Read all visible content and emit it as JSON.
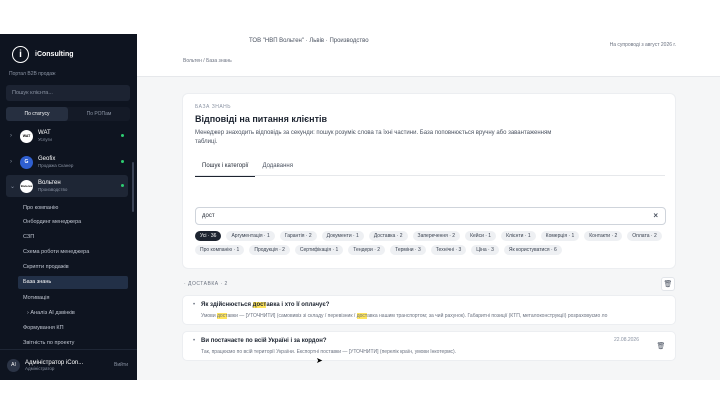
{
  "sidebar": {
    "app_name": "iConsulting",
    "subtitle": "Портал B2B продаж",
    "search_placeholder": "Пошук клієнта...",
    "toggle": [
      "По статусу",
      "По РОПам"
    ],
    "clients": [
      {
        "name": "WAT",
        "sub": "Услуги",
        "avatar": "WAT"
      },
      {
        "name": "Geofix",
        "sub": "Продажа Сканер",
        "avatar": "G"
      },
      {
        "name": "Вольтен",
        "sub": "Производство",
        "avatar": "Вольтен"
      }
    ],
    "menu": [
      "Про компанію",
      "Онбординг менеджера",
      "СЗП",
      "Схема роботи менеджера",
      "Скрипти продажів",
      "База знань",
      "Мотивація",
      "Аналіз AI дзвінків",
      "Формування КП",
      "Звітність по проекту"
    ],
    "user": {
      "name": "Адміністратор iCon...",
      "role": "Адміністратор",
      "initials": "AI",
      "logout": "Вийти"
    }
  },
  "header": {
    "company": "ТОВ \"НВП Вольтен\" · Львів · Производство",
    "since": "На супроводі з август 2026 г."
  },
  "breadcrumb": "Вольтен  / База знань",
  "card": {
    "eyebrow": "БАЗА ЗНАНЬ",
    "title": "Відповіді на питання клієнтів",
    "description": "Менеджер знаходить відповідь за секунди: пошук розуміє слова та їхні частини. База поповнюється вручну або завантаженням таблиці.",
    "tabs": [
      "Пошук і категорії",
      "Додавання"
    ],
    "search_value": "дост",
    "chips": [
      "Усі · 36",
      "Аргументація · 1",
      "Гарантія · 2",
      "Документи · 1",
      "Доставка · 2",
      "Заперечення · 2",
      "Кейси · 1",
      "Клієнти · 1",
      "Комерція · 1",
      "Контакти · 2",
      "Оплата · 2",
      "Про компанію · 1",
      "Продукція · 2",
      "Сертифікація · 1",
      "Тендери · 2",
      "Терміни · 3",
      "Технічні · 3",
      "Ціна · 3",
      "Як користуватися · 6"
    ]
  },
  "section": {
    "title": "· ДОСТАВКА · 2",
    "items": [
      {
        "q_pre": "Як здійснюється ",
        "q_mark": "дост",
        "q_post": "авка і хто її оплачує?",
        "a_pre": "Умови ",
        "a_mark1": "дост",
        "a_mid": "авки — [УТОЧНИТИ] (самовивіз зі складу / перевізник / ",
        "a_mark2": "дост",
        "a_post": "авка нашим транспортом; за чий рахунок). Габаритні позиції (КТП, металоконструкції) розраховуємо ло",
        "date": ""
      },
      {
        "q_pre": "Ви постачаєте по всій Україні і за кордон?",
        "q_mark": "",
        "q_post": "",
        "a_pre": "Так, працюємо по всій території України. Експортні поставки — [УТОЧНИТИ] (перелік країн, умови Інкотермс).",
        "a_mark1": "",
        "a_mid": "",
        "a_mark2": "",
        "a_post": "",
        "date": "22.08.2026"
      }
    ]
  }
}
